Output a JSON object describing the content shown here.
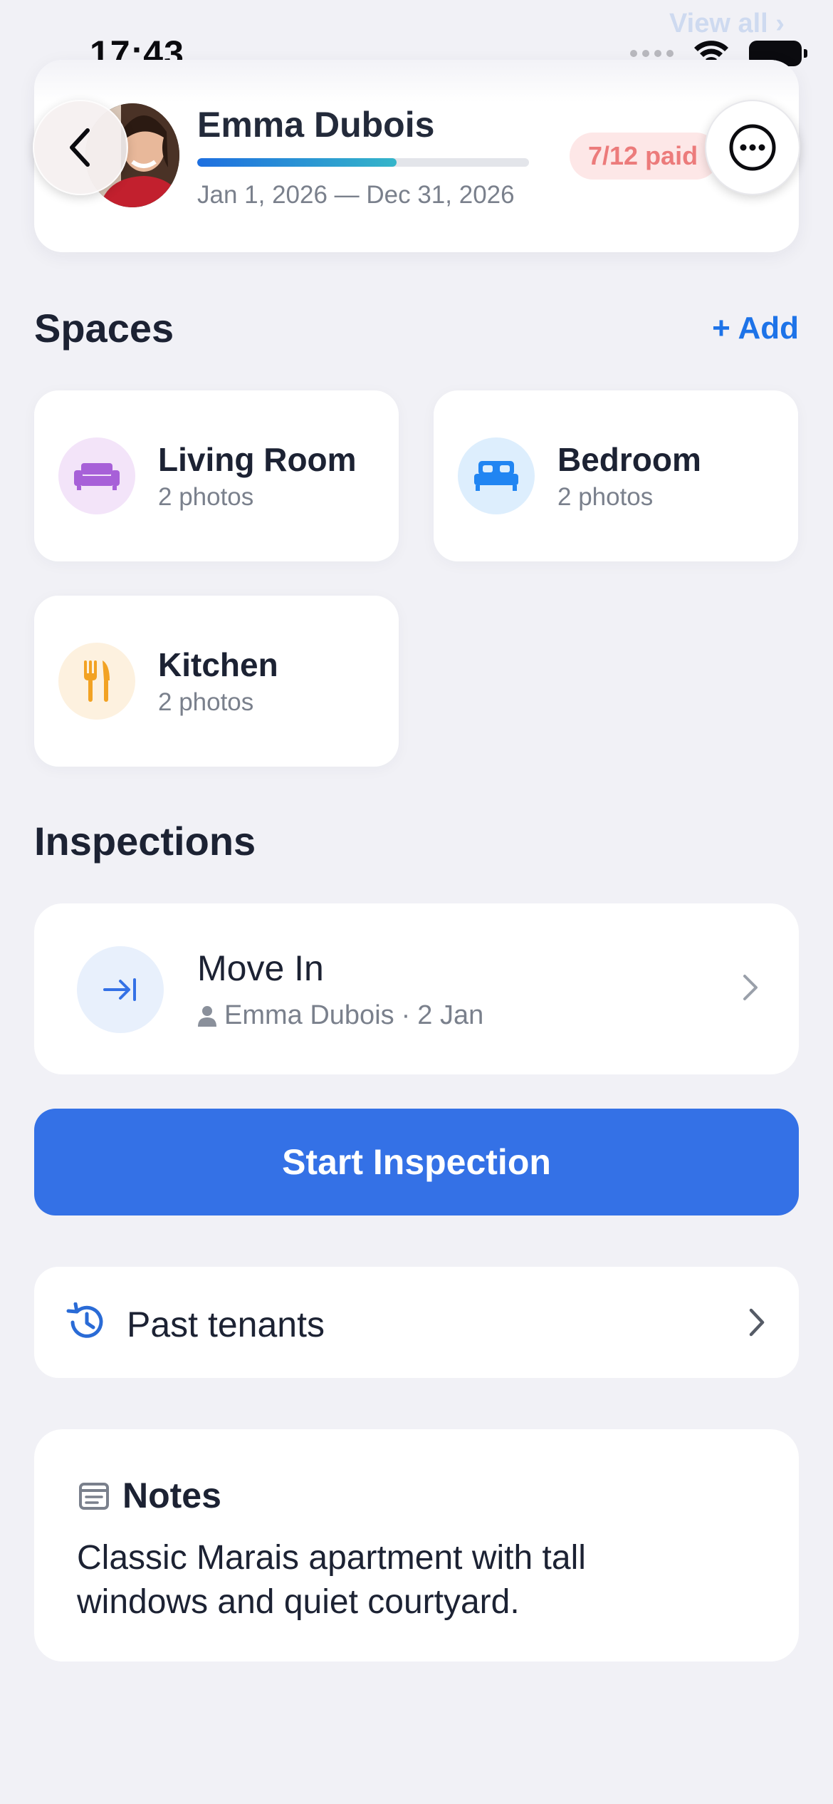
{
  "status_bar": {
    "time": "17:43"
  },
  "top_link": {
    "label": "View all",
    "chevron": "›"
  },
  "tenant": {
    "name": "Emma Dubois",
    "lease_dates": "Jan 1, 2026 — Dec 31, 2026",
    "paid_badge": "7/12 paid",
    "payment_progress": 0.6,
    "avatar": "avatar-photo"
  },
  "icons": {
    "back": "chevron-left-icon",
    "more": "ellipsis-circle-icon",
    "living": "sofa-icon",
    "bedroom": "bed-icon",
    "kitchen": "fork-knife-icon",
    "move_in": "arrow-to-line-icon",
    "person": "person-icon",
    "history": "history-icon",
    "notes": "note-icon"
  },
  "spaces": {
    "title": "Spaces",
    "add_label": "+ Add",
    "items": [
      {
        "name": "Living Room",
        "count": "2 photos",
        "color": "#a760d8",
        "bg": "#f3e4f9"
      },
      {
        "name": "Bedroom",
        "count": "2 photos",
        "color": "#2185f2",
        "bg": "#ddeefd"
      },
      {
        "name": "Kitchen",
        "count": "2 photos",
        "color": "#f2a223",
        "bg": "#fdf1df"
      }
    ]
  },
  "inspections": {
    "title": "Inspections",
    "items": [
      {
        "title": "Move In",
        "person": "Emma Dubois",
        "separator": "·",
        "date": "2 Jan"
      }
    ],
    "start_label": "Start Inspection"
  },
  "past_tenants": {
    "label": "Past tenants"
  },
  "notes": {
    "title": "Notes",
    "body": "Classic Marais apartment with tall windows and quiet courtyard."
  },
  "colors": {
    "accent": "#3471e6",
    "link": "#1d73e8",
    "badge_text": "#ec7b7b",
    "badge_bg": "#fde7e7"
  }
}
